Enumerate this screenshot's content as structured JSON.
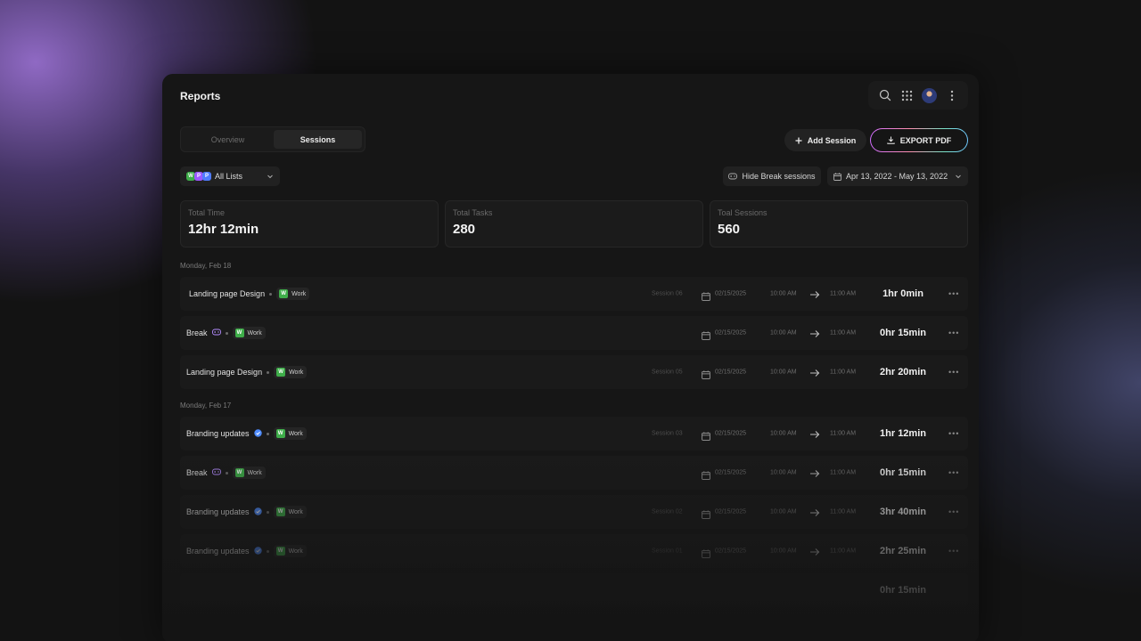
{
  "app": {
    "title": "Reports"
  },
  "tabs": [
    {
      "label": "Overview",
      "active": false
    },
    {
      "label": "Sessions",
      "active": true
    }
  ],
  "actions": {
    "add_session": "Add Session",
    "export_pdf": "EXPORT PDF"
  },
  "filters": {
    "list_badges": [
      {
        "letter": "W",
        "color": "#3fae4a"
      },
      {
        "letter": "P",
        "color": "#9b59ff"
      },
      {
        "letter": "P",
        "color": "#4f7cff"
      }
    ],
    "lists_label": "All Lists",
    "hide_break": "Hide Break sessions",
    "date_range": "Apr 13, 2022 - May 13, 2022"
  },
  "stats": [
    {
      "label": "Total Time",
      "value": "12hr 12min"
    },
    {
      "label": "Total Tasks",
      "value": "280"
    },
    {
      "label": "Toal Sessions",
      "value": "560"
    }
  ],
  "groups": [
    {
      "day": "Monday, Feb 18"
    },
    {
      "day": "Monday, Feb 17"
    }
  ],
  "sessions": [
    {
      "name": "Landing page Design",
      "icon": null,
      "tag": "Work",
      "session": "Session 06",
      "date": "02/15/2025",
      "start": "10:00 AM",
      "end": "11:00 AM",
      "duration": "1hr 0min",
      "opacity": 1
    },
    {
      "name": "Break",
      "icon": "break-icon",
      "tag": "Work",
      "session": "",
      "date": "02/15/2025",
      "start": "10:00 AM",
      "end": "11:00 AM",
      "duration": "0hr 15min",
      "opacity": 1
    },
    {
      "name": "Landing page Design",
      "icon": null,
      "tag": "Work",
      "session": "Session 05",
      "date": "02/15/2025",
      "start": "10:00 AM",
      "end": "11:00 AM",
      "duration": "2hr 20min",
      "opacity": 1
    },
    {
      "name": "Branding updates",
      "icon": "verified-icon",
      "tag": "Work",
      "session": "Session 03",
      "date": "02/15/2025",
      "start": "10:00 AM",
      "end": "11:00 AM",
      "duration": "1hr 12min",
      "opacity": 1
    },
    {
      "name": "Break",
      "icon": "break-icon",
      "tag": "Work",
      "session": "",
      "date": "02/15/2025",
      "start": "10:00 AM",
      "end": "11:00 AM",
      "duration": "0hr 15min",
      "opacity": 1
    },
    {
      "name": "Branding updates",
      "icon": "verified-icon",
      "tag": "Work",
      "session": "Session 02",
      "date": "02/15/2025",
      "start": "10:00 AM",
      "end": "11:00 AM",
      "duration": "3hr 40min",
      "opacity": 1
    },
    {
      "name": "Branding updates",
      "icon": "verified-icon",
      "tag": "Work",
      "session": "Session 01",
      "date": "02/15/2025",
      "start": "10:00 AM",
      "end": "11:00 AM",
      "duration": "2hr 25min",
      "opacity": 1
    },
    {
      "name": "",
      "icon": null,
      "tag": "",
      "session": "",
      "date": "",
      "start": "",
      "end": "",
      "duration": "0hr 15min",
      "opacity": 1
    }
  ]
}
